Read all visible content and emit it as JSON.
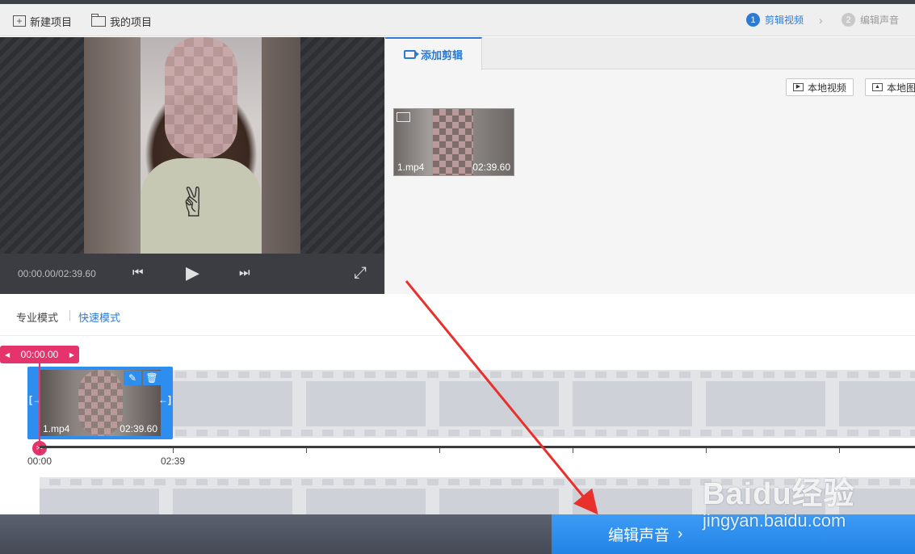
{
  "toolbar": {
    "new_project": "新建项目",
    "my_projects": "我的项目",
    "steps": [
      {
        "num": "1",
        "label": "剪辑视频"
      },
      {
        "num": "2",
        "label": "编辑声音"
      }
    ]
  },
  "player": {
    "timecode": "00:00.00/02:39.60"
  },
  "media_panel": {
    "tab_label": "添加剪辑",
    "local_video_button": "本地视频",
    "local_image_button": "本地图片",
    "clip": {
      "name": "1.mp4",
      "duration": "02:39.60"
    }
  },
  "modes": {
    "pro": "专业模式",
    "fast": "快速模式",
    "active": "fast"
  },
  "timeline": {
    "playhead_time": "00:00.00",
    "clip": {
      "name": "1.mp4",
      "duration": "02:39.60"
    },
    "ruler_labels": [
      "00:00",
      "02:39"
    ]
  },
  "footer": {
    "next_button": "编辑声音"
  },
  "watermark": {
    "brand": "Baidu经验",
    "url": "jingyan.baidu.com"
  },
  "colors": {
    "accent": "#2b7bd6",
    "playhead": "#e5336b",
    "next_button": "#2d8ef0",
    "annotation_arrow": "#e8302d"
  }
}
